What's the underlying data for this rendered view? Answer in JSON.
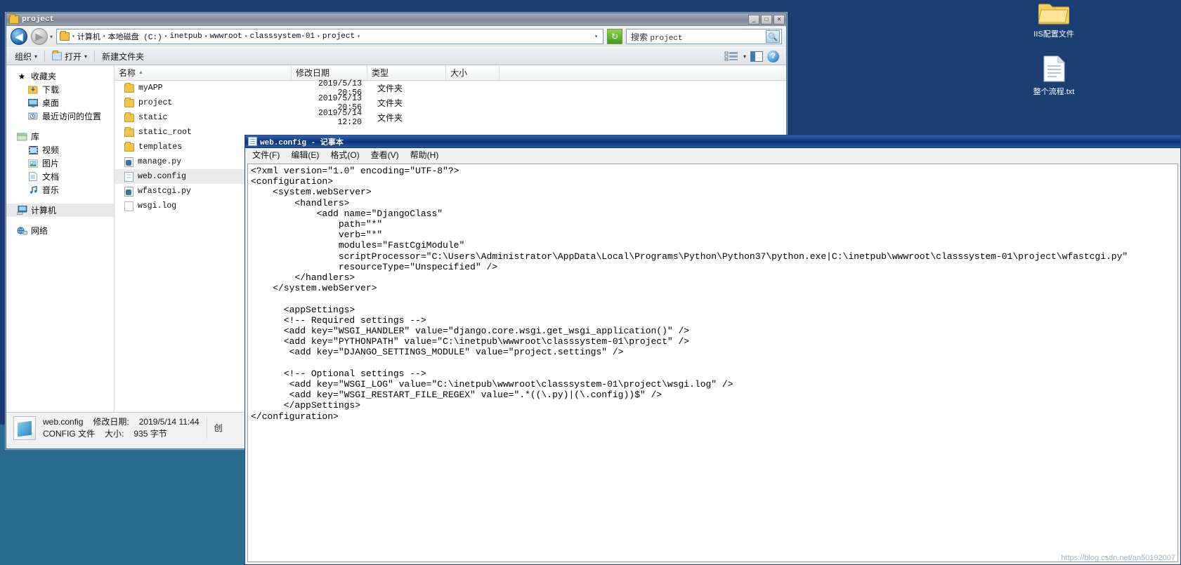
{
  "desktop": {
    "icons": [
      {
        "name": "iis-config-file",
        "label": "IIS配置文件",
        "glyph": "folder"
      },
      {
        "name": "whole-process-txt",
        "label": "整个流程.txt",
        "glyph": "textfile"
      }
    ],
    "watermark": "https://blog.csdn.net/an50192007"
  },
  "explorer": {
    "title": "project",
    "window_buttons": {
      "minimize": "_",
      "maximize": "□",
      "close": "✕"
    },
    "address": {
      "crumbs": [
        "计算机",
        "本地磁盘 (C:)",
        "inetpub",
        "wwwroot",
        "classsystem-01",
        "project"
      ],
      "separator": "▾",
      "refresh_icon": "refresh-icon"
    },
    "search": {
      "prefix": "搜索 ",
      "value": "project",
      "placeholder": "搜索 project",
      "icon": "search-icon"
    },
    "commandbar": {
      "organize": "组织",
      "open": "打开",
      "new_folder": "新建文件夹",
      "view_icon": "view-list-icon",
      "preview_icon": "preview-pane-icon",
      "help_icon": "help-icon",
      "caret": "▾"
    },
    "navpane": {
      "groups": [
        {
          "name": "favorites",
          "header": {
            "label": "收藏夹",
            "icon": "star-icon"
          },
          "items": [
            {
              "label": "下载",
              "icon": "download-icon"
            },
            {
              "label": "桌面",
              "icon": "desktop-icon"
            },
            {
              "label": "最近访问的位置",
              "icon": "recent-places-icon"
            }
          ]
        },
        {
          "name": "libraries",
          "header": {
            "label": "库",
            "icon": "library-icon"
          },
          "items": [
            {
              "label": "视频",
              "icon": "video-icon"
            },
            {
              "label": "图片",
              "icon": "pictures-icon"
            },
            {
              "label": "文档",
              "icon": "documents-icon"
            },
            {
              "label": "音乐",
              "icon": "music-icon"
            }
          ]
        },
        {
          "name": "computer",
          "header": {
            "label": "计算机",
            "icon": "computer-icon",
            "selected": true
          },
          "items": []
        },
        {
          "name": "network",
          "header": {
            "label": "网络",
            "icon": "network-icon"
          },
          "items": []
        }
      ]
    },
    "filelist": {
      "columns": [
        {
          "label": "名称",
          "sorted": true,
          "caret": "▲"
        },
        {
          "label": "修改日期",
          "sorted": false,
          "caret": ""
        },
        {
          "label": "类型",
          "sorted": false,
          "caret": ""
        },
        {
          "label": "大小",
          "sorted": false,
          "caret": ""
        }
      ],
      "rows": [
        {
          "name": "myAPP",
          "date": "2019/5/13 20:56",
          "type": "文件夹",
          "size": "",
          "icon": "folder-icon",
          "selected": false
        },
        {
          "name": "project",
          "date": "2019/5/13 20:56",
          "type": "文件夹",
          "size": "",
          "icon": "folder-icon",
          "selected": false
        },
        {
          "name": "static",
          "date": "2019/5/14 12:20",
          "type": "文件夹",
          "size": "",
          "icon": "folder-icon",
          "selected": false
        },
        {
          "name": "static_root",
          "date": "",
          "type": "",
          "size": "",
          "icon": "folder-icon",
          "selected": false
        },
        {
          "name": "templates",
          "date": "",
          "type": "",
          "size": "",
          "icon": "folder-icon",
          "selected": false
        },
        {
          "name": "manage.py",
          "date": "",
          "type": "",
          "size": "",
          "icon": "python-file-icon",
          "selected": false
        },
        {
          "name": "web.config",
          "date": "",
          "type": "",
          "size": "",
          "icon": "config-file-icon",
          "selected": true
        },
        {
          "name": "wfastcgi.py",
          "date": "",
          "type": "",
          "size": "",
          "icon": "python-file-icon",
          "selected": false
        },
        {
          "name": "wsgi.log",
          "date": "",
          "type": "",
          "size": "",
          "icon": "log-file-icon",
          "selected": false
        }
      ]
    },
    "details": {
      "icon": "config-file-large-icon",
      "line1_name": "web.config",
      "line1_label": "修改日期:",
      "line1_value": "2019/5/14 11:44",
      "line2_type": "CONFIG 文件",
      "line2_label": "大小:",
      "line2_value": "935 字节",
      "extra_label": "创"
    }
  },
  "notepad": {
    "title": "web.config - 记事本",
    "icon": "notepad-icon",
    "menu": [
      "文件(F)",
      "编辑(E)",
      "格式(O)",
      "查看(V)",
      "帮助(H)"
    ],
    "content": "<?xml version=\"1.0\" encoding=\"UTF-8\"?>\n<configuration>\n    <system.webServer>\n        <handlers>\n            <add name=\"DjangoClass\"\n                path=\"*\"\n                verb=\"*\"\n                modules=\"FastCgiModule\"\n                scriptProcessor=\"C:\\Users\\Administrator\\AppData\\Local\\Programs\\Python\\Python37\\python.exe|C:\\inetpub\\wwwroot\\classsystem-01\\project\\wfastcgi.py\"\n                resourceType=\"Unspecified\" />\n        </handlers>\n    </system.webServer>\n\n      <appSettings>\n      <!-- Required settings -->\n      <add key=\"WSGI_HANDLER\" value=\"django.core.wsgi.get_wsgi_application()\" />\n      <add key=\"PYTHONPATH\" value=\"C:\\inetpub\\wwwroot\\classsystem-01\\project\" />\n       <add key=\"DJANGO_SETTINGS_MODULE\" value=\"project.settings\" />\n\n      <!-- Optional settings -->\n       <add key=\"WSGI_LOG\" value=\"C:\\inetpub\\wwwroot\\classsystem-01\\project\\wsgi.log\" />\n       <add key=\"WSGI_RESTART_FILE_REGEX\" value=\".*((\\.py)|(\\.config))$\" />\n      </appSettings>\n</configuration>"
  }
}
